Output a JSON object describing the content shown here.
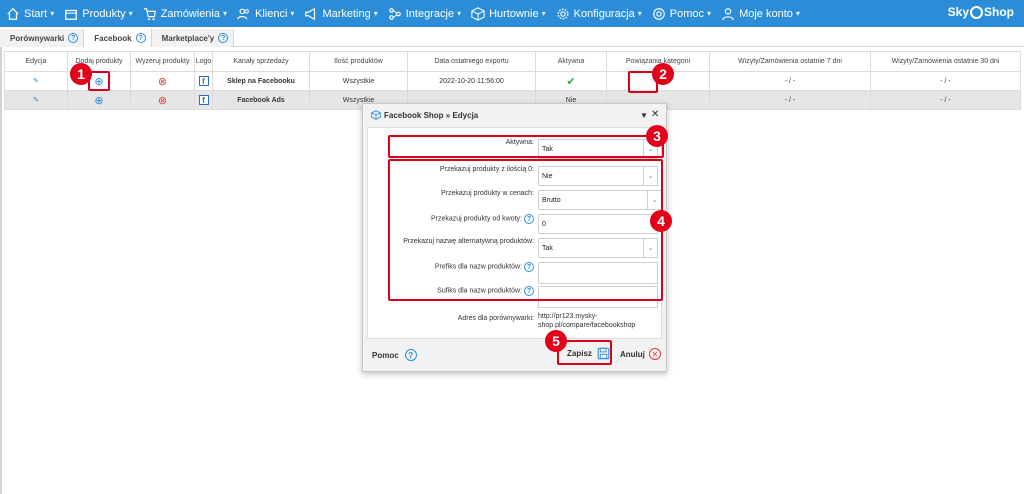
{
  "nav": {
    "items": [
      {
        "label": "Start",
        "icon": "home-icon"
      },
      {
        "label": "Produkty",
        "icon": "box-icon"
      },
      {
        "label": "Zamówienia",
        "icon": "cart-icon"
      },
      {
        "label": "Klienci",
        "icon": "users-icon"
      },
      {
        "label": "Marketing",
        "icon": "megaphone-icon"
      },
      {
        "label": "Integracje",
        "icon": "integration-icon"
      },
      {
        "label": "Hurtownie",
        "icon": "package-icon"
      },
      {
        "label": "Konfiguracja",
        "icon": "gear-icon"
      },
      {
        "label": "Pomoc",
        "icon": "lifebuoy-icon"
      },
      {
        "label": "Moje konto",
        "icon": "user-icon"
      }
    ],
    "brand_left": "Sky",
    "brand_right": "Shop",
    "accent": "#2b8dd8"
  },
  "tabs": [
    {
      "label": "Porównywarki"
    },
    {
      "label": "Facebook"
    },
    {
      "label": "Marketplace'y"
    }
  ],
  "table": {
    "headers": [
      "Edycja",
      "Dodaj produkty",
      "Wyzeruj produkty",
      "Logo",
      "Kanały sprzedaży",
      "Ilość produktów",
      "Data ostatniego exportu",
      "Aktywna",
      "Powiązania kategorii",
      "Wizyty/Zamówienia ostatnie 7 dni",
      "Wizyty/Zamówienia ostatnie 30 dni"
    ],
    "rows": [
      {
        "channel": "Sklep na Facebooku",
        "count": "Wszystkie",
        "last_export": "2022-10-20 11:56:00",
        "visits7": "- / -",
        "visits30": "- / -"
      },
      {
        "channel": "Facebook Ads",
        "count": "Wszystkie",
        "last_export": "",
        "active_text": "Nie",
        "visits7": "- / -",
        "visits30": "- / -"
      }
    ]
  },
  "modal": {
    "title": "Facebook Shop » Edycja",
    "fields": {
      "active": {
        "label": "Aktywna:",
        "value": "Tak"
      },
      "zero_qty": {
        "label": "Przekazuj produkty z ilością 0:",
        "value": "Nie"
      },
      "prices": {
        "label": "Przekazuj produkty w cenach:",
        "value": "Brutto"
      },
      "from_amount": {
        "label": "Przekazuj produkty od kwoty:",
        "value": "0"
      },
      "alt_name": {
        "label": "Przekazuj nazwę alternatywną produktów:",
        "value": "Tak"
      },
      "prefix": {
        "label": "Prefiks dla nazw produktów:",
        "value": ""
      },
      "suffix": {
        "label": "Sufiks dla nazw produktów:",
        "value": ""
      },
      "address": {
        "label": "Adres dla porównywarki:",
        "value_line1": "http://pr123.mysky-",
        "value_line2": "shop.pl/compare/facebookshop"
      }
    },
    "footer": {
      "help": "Pomoc",
      "save": "Zapisz",
      "cancel": "Anuluj"
    }
  },
  "callouts": [
    "1",
    "2",
    "3",
    "4",
    "5"
  ],
  "colors": {
    "callout_red": "#e3001a",
    "header_blue": "#2b8dd8",
    "row_gray": "#e6e6e6"
  }
}
